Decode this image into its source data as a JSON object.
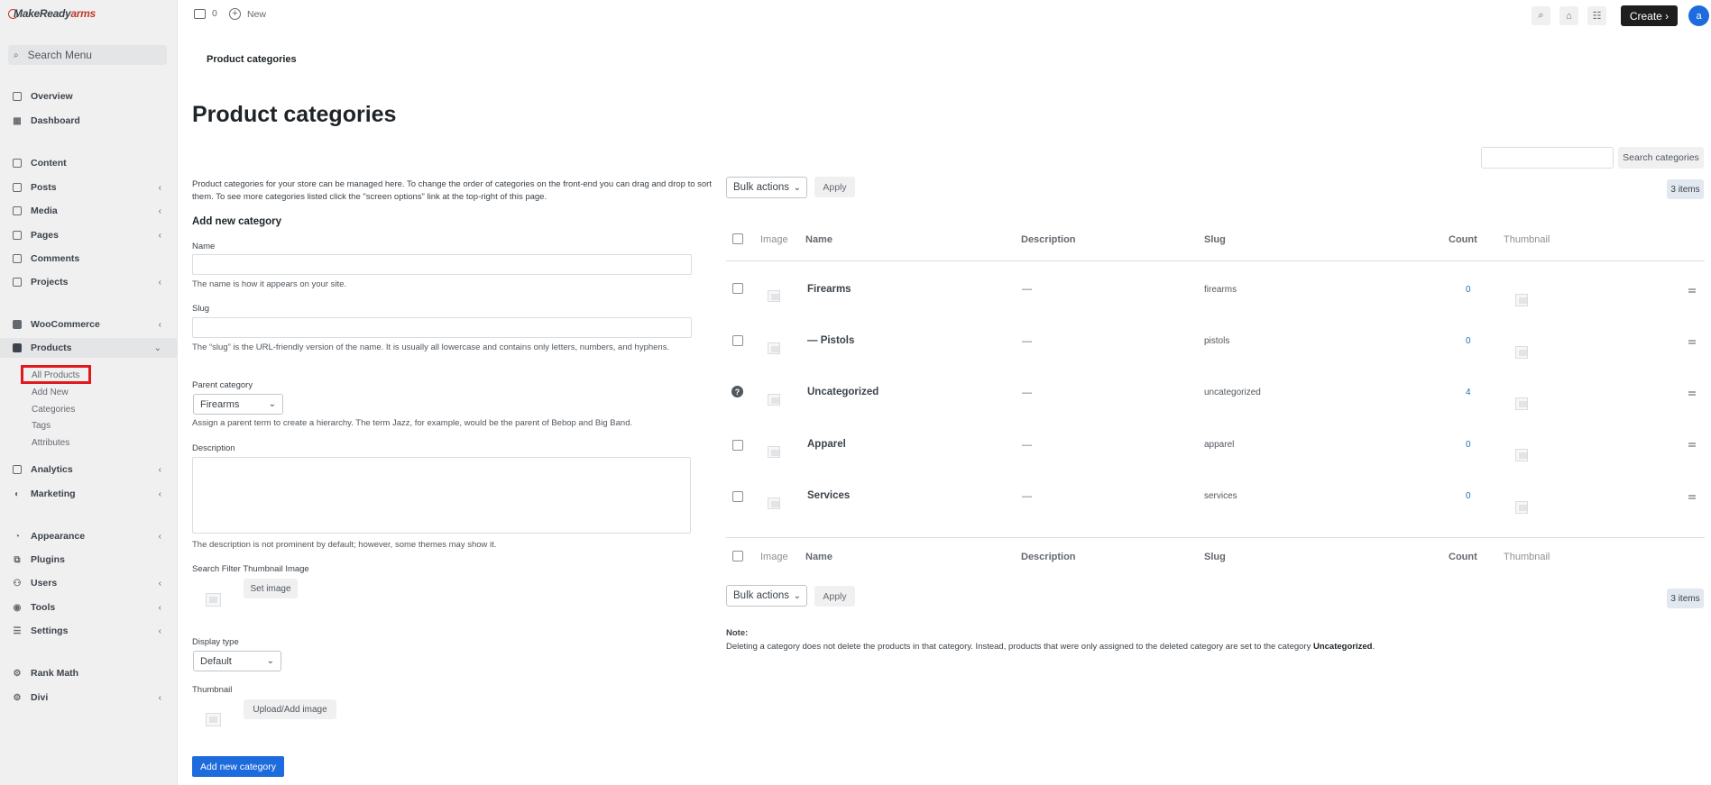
{
  "app": {
    "logo_prefix": "Make",
    "logo_middle": "Ready",
    "logo_suffix": "arms"
  },
  "sidebar": {
    "search_placeholder": "Search Menu",
    "items": [
      {
        "label": "Overview"
      },
      {
        "label": "Dashboard"
      },
      {
        "label": "Content"
      },
      {
        "label": "Posts"
      },
      {
        "label": "Media"
      },
      {
        "label": "Pages"
      },
      {
        "label": "Comments"
      },
      {
        "label": "Projects"
      },
      {
        "label": "WooCommerce"
      },
      {
        "label": "Products"
      },
      {
        "label": "Analytics"
      },
      {
        "label": "Marketing"
      },
      {
        "label": "Appearance"
      },
      {
        "label": "Plugins"
      },
      {
        "label": "Users"
      },
      {
        "label": "Tools"
      },
      {
        "label": "Settings"
      },
      {
        "label": "Rank Math"
      },
      {
        "label": "Divi"
      }
    ],
    "products_sub": [
      "All Products",
      "Add New",
      "Categories",
      "Tags",
      "Attributes"
    ]
  },
  "topbar": {
    "comments_count": "0",
    "new_label": "New",
    "create_label": "Create ›",
    "avatar_letter": "a"
  },
  "page": {
    "breadcrumb": "Product categories",
    "title": "Product categories",
    "search_button": "Search categories",
    "intro": "Product categories for your store can be managed here. To change the order of categories on the front-end you can drag and drop to sort them. To see more categories listed click the \"screen options\" link at the top-right of this page."
  },
  "form": {
    "heading": "Add new category",
    "name_label": "Name",
    "name_help": "The name is how it appears on your site.",
    "slug_label": "Slug",
    "slug_help": "The “slug” is the URL-friendly version of the name. It is usually all lowercase and contains only letters, numbers, and hyphens.",
    "parent_label": "Parent category",
    "parent_value": "Firearms",
    "parent_help": "Assign a parent term to create a hierarchy. The term Jazz, for example, would be the parent of Bebop and Big Band.",
    "description_label": "Description",
    "description_help": "The description is not prominent by default; however, some themes may show it.",
    "filter_thumb_label": "Search Filter Thumbnail Image",
    "set_image": "Set image",
    "display_type_label": "Display type",
    "display_type_value": "Default",
    "thumbnail_label": "Thumbnail",
    "upload_button": "Upload/Add image",
    "submit": "Add new category"
  },
  "table": {
    "bulk_actions": "Bulk actions",
    "apply": "Apply",
    "items_count": "3 items",
    "columns": {
      "image": "Image",
      "name": "Name",
      "description": "Description",
      "slug": "Slug",
      "count": "Count",
      "thumbnail": "Thumbnail"
    },
    "rows": [
      {
        "name": "Firearms",
        "description": "—",
        "slug": "firearms",
        "count": "0"
      },
      {
        "name": "— Pistols",
        "description": "—",
        "slug": "pistols",
        "count": "0"
      },
      {
        "name": "Uncategorized",
        "description": "—",
        "slug": "uncategorized",
        "count": "4"
      },
      {
        "name": "Apparel",
        "description": "—",
        "slug": "apparel",
        "count": "0"
      },
      {
        "name": "Services",
        "description": "—",
        "slug": "services",
        "count": "0"
      }
    ],
    "note_label": "Note:",
    "note_text": "Deleting a category does not delete the products in that category. Instead, products that were only assigned to the deleted category are set to the category ",
    "note_bold": "Uncategorized",
    "note_end": "."
  },
  "colors": {
    "accent": "#1d6bdc",
    "highlight_box": "#e0191e"
  }
}
